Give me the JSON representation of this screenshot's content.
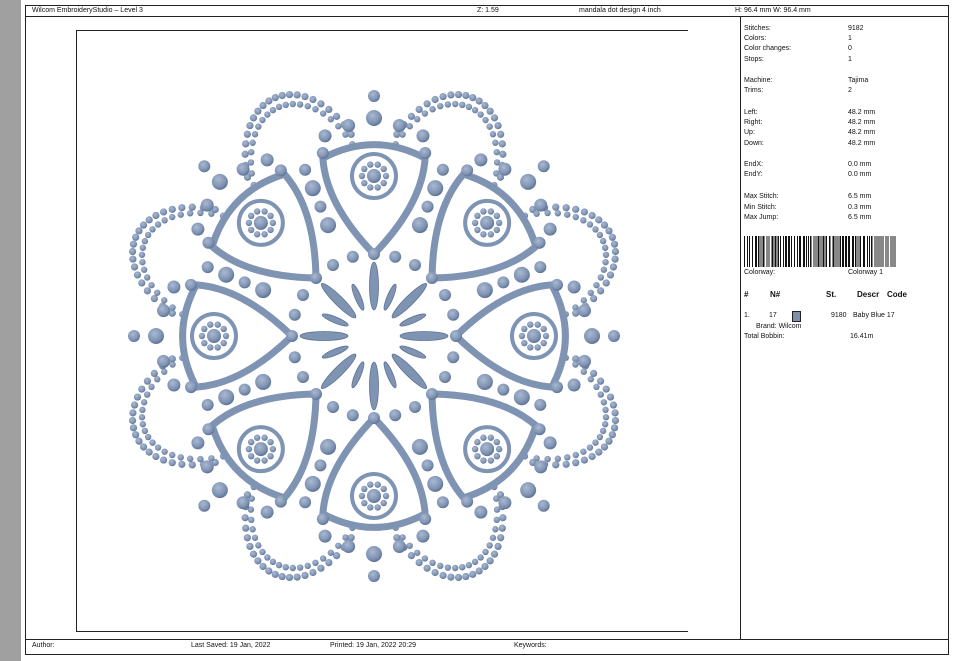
{
  "header": {
    "app": "Wilcom EmbroideryStudio – Level 3",
    "zoom": "Z: 1.59",
    "design_name": "mandala dot design 4 inch",
    "size": "H: 96.4 mm   W: 96.4 mm"
  },
  "stats": [
    {
      "label": "Stitches:",
      "value": "9182"
    },
    {
      "label": "Colors:",
      "value": "1"
    },
    {
      "label": "Color changes:",
      "value": "0"
    },
    {
      "label": "Stops:",
      "value": "1"
    },
    {
      "label": "Machine:",
      "value": "Tajima"
    },
    {
      "label": "Trims:",
      "value": "2"
    },
    {
      "label": "Left:",
      "value": "48.2 mm"
    },
    {
      "label": "Right:",
      "value": "48.2 mm"
    },
    {
      "label": "Up:",
      "value": "48.2 mm"
    },
    {
      "label": "Down:",
      "value": "48.2 mm"
    },
    {
      "label": "EndX:",
      "value": "0.0 mm"
    },
    {
      "label": "EndY:",
      "value": "0.0 mm"
    },
    {
      "label": "Max Stitch:",
      "value": "6.5 mm"
    },
    {
      "label": "Min Stitch:",
      "value": "0.3 mm"
    },
    {
      "label": "Max Jump:",
      "value": "6.5 mm"
    }
  ],
  "colorway": {
    "label": "Colorway:",
    "value": "Colorway 1"
  },
  "color_table": {
    "headers": [
      "#",
      "N#",
      "St.",
      "Descr",
      "Code"
    ],
    "rows": [
      {
        "index": "1.",
        "n": "17",
        "stitches": "9180",
        "descr": "Baby Blue 17",
        "swatch_color": "#7f8fab"
      }
    ],
    "brand": "Brand: Wilcom",
    "total_bobbin_label": "Total Bobbin:",
    "total_bobbin_value": "16.41m"
  },
  "footer": {
    "author": "Author:",
    "last_saved": "Last Saved: 19 Jan, 2022",
    "printed": "Printed: 19 Jan, 2022 20:29",
    "keywords": "Keywords:"
  },
  "design": {
    "thread_color": "#7f93b3",
    "thread_dark": "#5e7396",
    "thread_light": "#a9b9d1"
  }
}
